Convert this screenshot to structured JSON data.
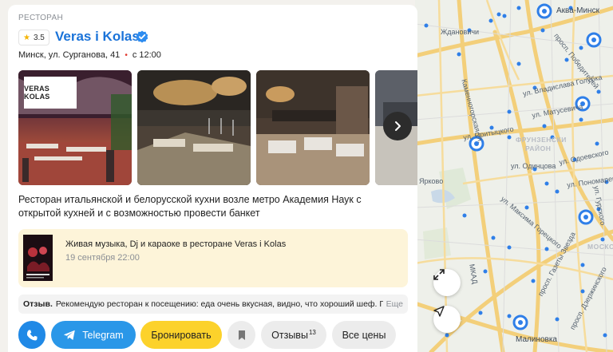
{
  "card": {
    "category": "РЕСТОРАН",
    "rating": "3.5",
    "title": "Veras i Kolas",
    "address": "Минск, ул. Сурганова, 41",
    "hours": "с 12:00",
    "photo_logo_text": "VERAS KOLAS",
    "description": "Ресторан итальянской и белорусской кухни возле метро Академия Наук с открытой кухней и с возможностью провести банкет",
    "event": {
      "title": "Живая музыка, Dj и караоке в ресторане Veras i Kolas",
      "date": "19 сентября 22:00"
    },
    "review": {
      "label": "Отзыв.",
      "text": "Рекомендую ресторан к посещению: еда очень вкусная, видно, что хороший шеф. Пе…",
      "more": "Еще"
    },
    "actions": {
      "telegram": "Telegram",
      "book": "Бронировать",
      "reviews": "Отзывы",
      "reviews_count": "13",
      "prices": "Все цены"
    }
  },
  "map": {
    "labels": {
      "akva_minsk": "Аква-Минск",
      "zhdanovichi": "Ждановичи",
      "prosp_pobediteley": "просп. Победителей",
      "ul_vladislava_golubka": "ул. Владислава Голубка",
      "ul_matusevicha": "ул. Матусевича",
      "kamennogorskaya": "Каменногорская ул.",
      "ul_pritytskogo": "ул. Притыцкого",
      "frunzensky_1": "ФРУНЗЕНСКИ",
      "frunzensky_2": "РАЙОН",
      "ul_odoevskogo": "ул. Одоевского",
      "ul_odintsova": "ул. Одинцова",
      "yarkovo": "Ярково",
      "ul_ponomarenko": "ул. Пономаренко",
      "ul_maksima_goretskogo": "ул. Максима Горецкого",
      "ul_gurskogo": "ул. Гурского",
      "mkad": "МКАД",
      "moskovsky": "МОСКО",
      "prosp_gazety_zvyazda": "просп. Газеты Звезда",
      "prosp_dzerzhinskogo": "просп. Дзержинского",
      "malinovka": "Малиновка"
    }
  },
  "colors": {
    "link_blue": "#1a73d9",
    "accent_yellow": "#fcd22b",
    "telegram_blue": "#2a97e8",
    "phone_blue": "#2089e6",
    "event_bg": "#fdf4d9",
    "hours_dot": "#e0342b"
  },
  "icons": {
    "rating": "star-icon",
    "verified": "verified-check-icon",
    "next": "chevron-right-icon",
    "phone": "phone-icon",
    "telegram": "telegram-icon",
    "bookmark": "bookmark-icon",
    "expand": "expand-icon",
    "locate": "navigation-arrow-icon"
  }
}
